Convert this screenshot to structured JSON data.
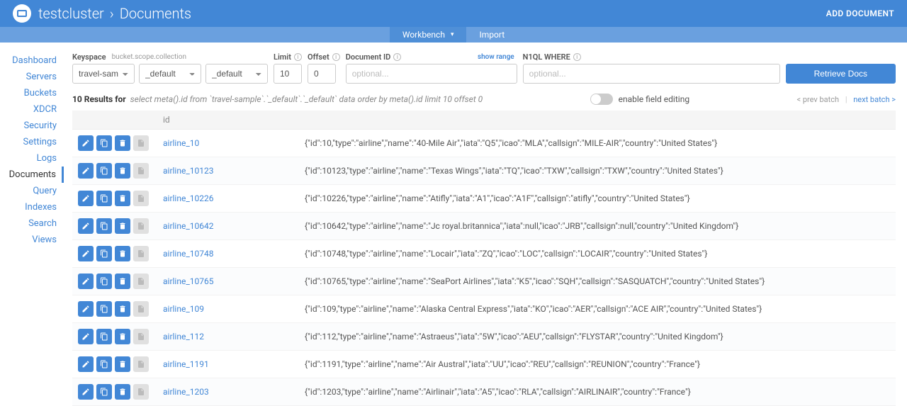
{
  "header": {
    "cluster": "testcluster",
    "separator": "›",
    "section": "Documents",
    "add_document": "ADD DOCUMENT"
  },
  "subnav": {
    "workbench": "Workbench",
    "import": "Import"
  },
  "sidebar": {
    "dashboard": "Dashboard",
    "servers": "Servers",
    "buckets": "Buckets",
    "xdcr": "XDCR",
    "security": "Security",
    "settings": "Settings",
    "logs": "Logs",
    "documents": "Documents",
    "query": "Query",
    "indexes": "Indexes",
    "search": "Search",
    "views": "Views"
  },
  "controls": {
    "keyspace_label": "Keyspace",
    "keyspace_sub": "bucket.scope.collection",
    "bucket": "travel-sample",
    "scope": "_default",
    "collection": "_default",
    "limit_label": "Limit",
    "limit_value": "10",
    "offset_label": "Offset",
    "offset_value": "0",
    "docid_label": "Document ID",
    "docid_placeholder": "optional...",
    "showrange": "show range",
    "n1ql_label": "N1QL WHERE",
    "n1ql_placeholder": "optional...",
    "retrieve": "Retrieve Docs"
  },
  "results": {
    "prefix": "10 Results for",
    "query": "select meta().id from `travel-sample`.`_default`.`_default` data order by meta().id limit 10 offset 0",
    "toggle_label": "enable field editing",
    "prev": "< prev batch",
    "next": "next batch >",
    "id_header": "id"
  },
  "rows": [
    {
      "id": "airline_10",
      "json": "{\"id\":10,\"type\":\"airline\",\"name\":\"40-Mile Air\",\"iata\":\"Q5\",\"icao\":\"MLA\",\"callsign\":\"MILE-AIR\",\"country\":\"United States\"}"
    },
    {
      "id": "airline_10123",
      "json": "{\"id\":10123,\"type\":\"airline\",\"name\":\"Texas Wings\",\"iata\":\"TQ\",\"icao\":\"TXW\",\"callsign\":\"TXW\",\"country\":\"United States\"}"
    },
    {
      "id": "airline_10226",
      "json": "{\"id\":10226,\"type\":\"airline\",\"name\":\"Atifly\",\"iata\":\"A1\",\"icao\":\"A1F\",\"callsign\":\"atifly\",\"country\":\"United States\"}"
    },
    {
      "id": "airline_10642",
      "json": "{\"id\":10642,\"type\":\"airline\",\"name\":\"Jc royal.britannica\",\"iata\":null,\"icao\":\"JRB\",\"callsign\":null,\"country\":\"United Kingdom\"}"
    },
    {
      "id": "airline_10748",
      "json": "{\"id\":10748,\"type\":\"airline\",\"name\":\"Locair\",\"iata\":\"ZQ\",\"icao\":\"LOC\",\"callsign\":\"LOCAIR\",\"country\":\"United States\"}"
    },
    {
      "id": "airline_10765",
      "json": "{\"id\":10765,\"type\":\"airline\",\"name\":\"SeaPort Airlines\",\"iata\":\"K5\",\"icao\":\"SQH\",\"callsign\":\"SASQUATCH\",\"country\":\"United States\"}"
    },
    {
      "id": "airline_109",
      "json": "{\"id\":109,\"type\":\"airline\",\"name\":\"Alaska Central Express\",\"iata\":\"KO\",\"icao\":\"AER\",\"callsign\":\"ACE AIR\",\"country\":\"United States\"}"
    },
    {
      "id": "airline_112",
      "json": "{\"id\":112,\"type\":\"airline\",\"name\":\"Astraeus\",\"iata\":\"5W\",\"icao\":\"AEU\",\"callsign\":\"FLYSTAR\",\"country\":\"United Kingdom\"}"
    },
    {
      "id": "airline_1191",
      "json": "{\"id\":1191,\"type\":\"airline\",\"name\":\"Air Austral\",\"iata\":\"UU\",\"icao\":\"REU\",\"callsign\":\"REUNION\",\"country\":\"France\"}"
    },
    {
      "id": "airline_1203",
      "json": "{\"id\":1203,\"type\":\"airline\",\"name\":\"Airlinair\",\"iata\":\"A5\",\"icao\":\"RLA\",\"callsign\":\"AIRLINAIR\",\"country\":\"France\"}"
    }
  ]
}
